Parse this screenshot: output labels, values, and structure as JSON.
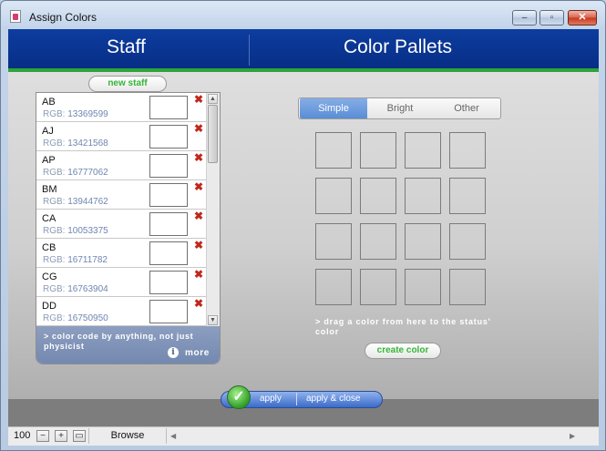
{
  "window": {
    "title": "Assign Colors",
    "minimize": "–",
    "maximize": "▫",
    "close": "✕"
  },
  "header": {
    "staff_title": "Staff",
    "pallets_title": "Color Pallets"
  },
  "staff": {
    "new_staff_label": "new staff",
    "rgb_prefix": "RGB:",
    "items": [
      {
        "name": "AB",
        "rgb": "13369599"
      },
      {
        "name": "AJ",
        "rgb": "13421568"
      },
      {
        "name": "AP",
        "rgb": "16777062"
      },
      {
        "name": "BM",
        "rgb": "13944762"
      },
      {
        "name": "CA",
        "rgb": "10053375"
      },
      {
        "name": "CB",
        "rgb": "16711782"
      },
      {
        "name": "CG",
        "rgb": "16763904"
      },
      {
        "name": "DD",
        "rgb": "16750950"
      }
    ],
    "footer_text": "> color code by anything, not just physicist",
    "more_label": "more",
    "info_glyph": "i"
  },
  "pallets": {
    "tabs": [
      "Simple",
      "Bright",
      "Other"
    ],
    "selected_tab": "Simple",
    "hint": "> drag a color from here to the status' color",
    "create_color_label": "create color"
  },
  "actions": {
    "apply_label": "apply",
    "apply_close_label": "apply & close",
    "check_glyph": "✓"
  },
  "statusbar": {
    "zoom": "100",
    "zoom_out": "−",
    "zoom_in": "+",
    "mode": "Browse",
    "left_arrow": "◀",
    "right_arrow": "▶"
  },
  "colors": {
    "header_blue": "#072e86",
    "accent_green": "#2ea33a",
    "delete_red": "#c0281c"
  }
}
